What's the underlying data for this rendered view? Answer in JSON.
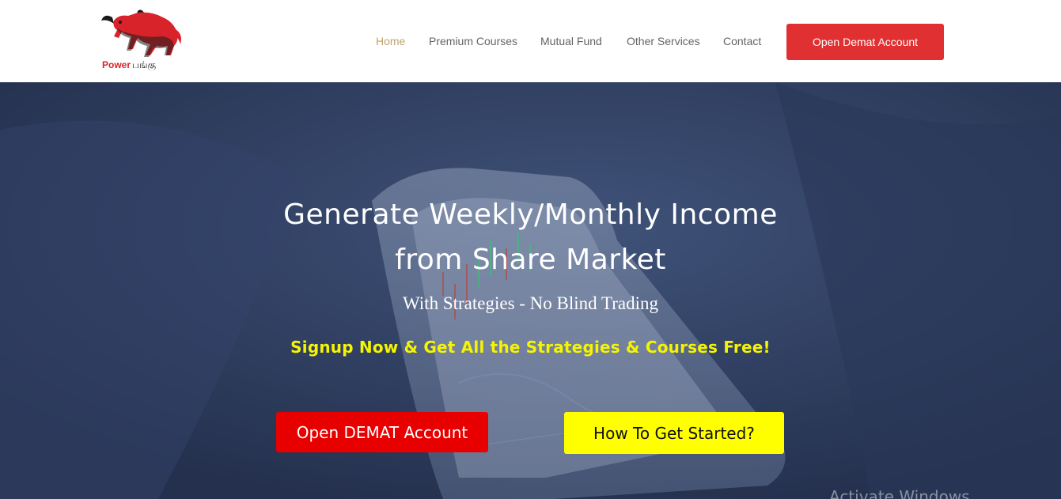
{
  "header": {
    "logo": {
      "brand_text": "Power",
      "tamil_text": "பங்கு",
      "icon": "red-bull-icon"
    },
    "nav": [
      {
        "label": "Home",
        "active": true
      },
      {
        "label": "Premium Courses",
        "active": false
      },
      {
        "label": "Mutual Fund",
        "active": false
      },
      {
        "label": "Other Services",
        "active": false
      },
      {
        "label": "Contact",
        "active": false
      }
    ],
    "cta_label": "Open Demat Account"
  },
  "hero": {
    "title_line1": "Generate Weekly/Monthly Income",
    "title_line2": "from Share Market",
    "subtitle": "With Strategies - No Blind Trading",
    "promo": "Signup Now & Get All the Strategies & Courses Free!",
    "primary_button": "Open DEMAT Account",
    "secondary_button": "How To Get Started?"
  },
  "overlay": {
    "watermark": "Activate Windows"
  },
  "colors": {
    "nav_active": "#c0a36b",
    "nav_text": "#646464",
    "header_cta_bg": "#e03031",
    "hero_overlay": "#2c3a5a",
    "promo_text": "#f5f500",
    "primary_button_bg": "#e80000",
    "secondary_button_bg": "#ffff00"
  }
}
